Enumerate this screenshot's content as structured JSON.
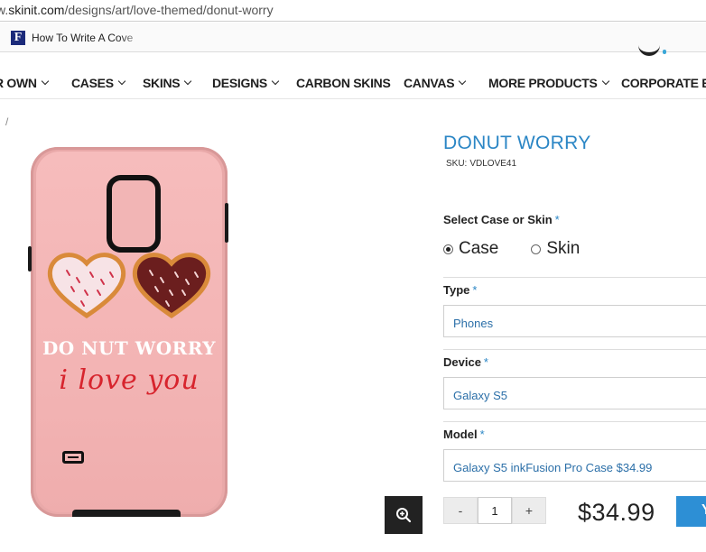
{
  "browser": {
    "url_prefix": "w.",
    "url_domain": "skinit.com",
    "url_path": "/designs/art/love-themed/donut-worry",
    "bookmark_label": "How To Write A Cove",
    "bookmark_favicon": "F"
  },
  "nav": {
    "items": [
      {
        "label": "R OWN",
        "dropdown": true
      },
      {
        "label": "CASES",
        "dropdown": true
      },
      {
        "label": "SKINS",
        "dropdown": true
      },
      {
        "label": "DESIGNS",
        "dropdown": true
      },
      {
        "label": "CARBON SKINS",
        "dropdown": false
      },
      {
        "label": "CANVAS",
        "dropdown": true
      },
      {
        "label": "MORE PRODUCTS",
        "dropdown": true
      },
      {
        "label": "CORPORATE BR",
        "dropdown": false
      }
    ]
  },
  "breadcrumb": "/",
  "product_image": {
    "title_line": "DO NUT WORRY",
    "script_line": "i love you"
  },
  "product": {
    "title": "DONUT WORRY",
    "sku_label": "SKU:",
    "sku": "VDLOVE41",
    "select_type_label": "Select Case or Skin",
    "required_mark": "*",
    "options": [
      {
        "label": "Case",
        "selected": true
      },
      {
        "label": "Skin",
        "selected": false
      }
    ],
    "type_label": "Type",
    "type_value": "Phones",
    "device_label": "Device",
    "device_value": "Galaxy S5",
    "model_label": "Model",
    "model_value": "Galaxy S5 inkFusion Pro Case $34.99",
    "qty_minus": "-",
    "qty_value": "1",
    "qty_plus": "+",
    "price": "$34.99",
    "add_label": "Y"
  },
  "colors": {
    "accent": "#2b86c5",
    "case_pink": "#f3b4b4",
    "text_red": "#d7242d"
  },
  "icons": {
    "zoom": "zoom-in-icon"
  }
}
